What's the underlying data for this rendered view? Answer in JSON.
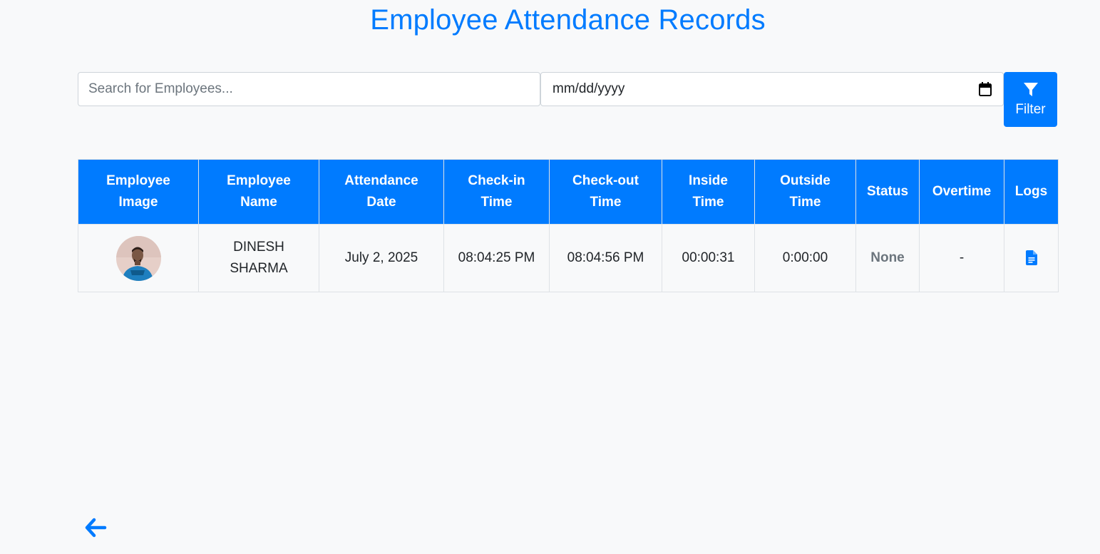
{
  "page": {
    "title": "Employee Attendance Records"
  },
  "search": {
    "placeholder": "Search for Employees...",
    "value": ""
  },
  "date_filter": {
    "placeholder": "mm/dd/yyyy"
  },
  "filter_button": {
    "label": "Filter",
    "icon": "filter-icon"
  },
  "table": {
    "headers": {
      "image": [
        "Employee",
        "Image"
      ],
      "name": [
        "Employee",
        "Name"
      ],
      "date": [
        "Attendance",
        "Date"
      ],
      "checkin": [
        "Check-in",
        "Time"
      ],
      "checkout": [
        "Check-out",
        "Time"
      ],
      "inside": [
        "Inside",
        "Time"
      ],
      "outside": [
        "Outside",
        "Time"
      ],
      "status": "Status",
      "overtime": "Overtime",
      "logs": "Logs"
    },
    "rows": [
      {
        "name_line1": "DINESH",
        "name_line2": "SHARMA",
        "date": "July 2, 2025",
        "checkin": "08:04:25 PM",
        "checkout": "08:04:56 PM",
        "inside": "00:00:31",
        "outside": "0:00:00",
        "status": "None",
        "overtime": "-",
        "logs_icon": "file-text-icon"
      }
    ]
  },
  "colors": {
    "primary": "#007bff",
    "background": "#f8f9fa",
    "muted": "#6c757d"
  },
  "back_button": {
    "icon": "arrow-left-icon"
  }
}
